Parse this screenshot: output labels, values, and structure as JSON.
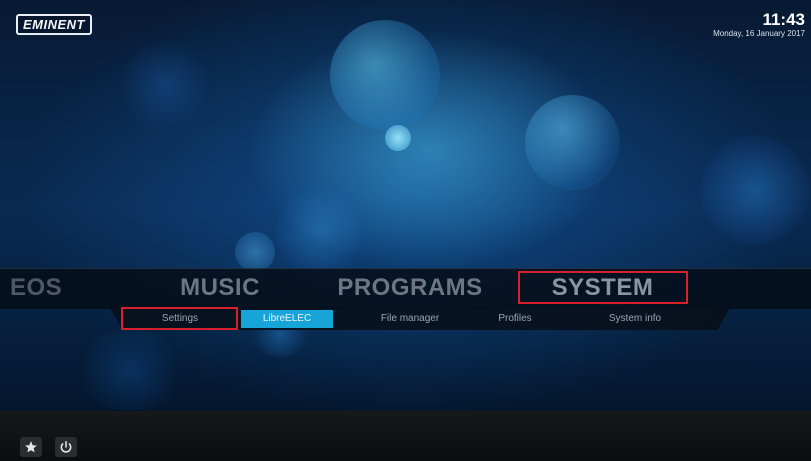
{
  "brand": {
    "logo_text": "EMINENT"
  },
  "status": {
    "time": "11:43",
    "date": "Monday, 16 January 2017"
  },
  "main_menu": {
    "items": [
      {
        "label": "EOS"
      },
      {
        "label": "MUSIC"
      },
      {
        "label": "PROGRAMS"
      },
      {
        "label": "SYSTEM"
      }
    ],
    "selected": "SYSTEM"
  },
  "submenu": {
    "items": [
      {
        "label": "Settings"
      },
      {
        "label": "LibreELEC"
      },
      {
        "label": "File manager"
      },
      {
        "label": "Profiles"
      },
      {
        "label": "System info"
      }
    ],
    "focused": "LibreELEC",
    "highlighted": "Settings"
  },
  "bottom_bar": {
    "favourites_icon": "star-icon",
    "power_icon": "power-icon"
  },
  "colors": {
    "highlight_box": "#d8202a",
    "focus": "#17a4d9",
    "background": "#0a2a52"
  }
}
